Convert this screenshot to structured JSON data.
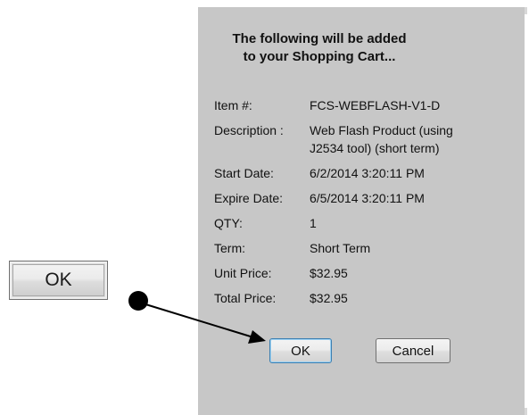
{
  "callout": {
    "ok_label": "OK"
  },
  "dialog": {
    "heading_line1": "The following will be added",
    "heading_line2": "to your Shopping Cart...",
    "fields": {
      "item": {
        "label": "Item #:",
        "value": "FCS-WEBFLASH-V1-D"
      },
      "description": {
        "label": "Description :",
        "value_line1": "Web Flash Product (using",
        "value_line2": "J2534 tool) (short term)"
      },
      "start_date": {
        "label": "Start Date:",
        "value": "6/2/2014 3:20:11 PM"
      },
      "expire_date": {
        "label": "Expire Date:",
        "value": "6/5/2014 3:20:11 PM"
      },
      "qty": {
        "label": "QTY:",
        "value": "1"
      },
      "term": {
        "label": "Term:",
        "value": "Short Term"
      },
      "unit_price": {
        "label": "Unit Price:",
        "value": "$32.95"
      },
      "total_price": {
        "label": "Total Price:",
        "value": "$32.95"
      }
    },
    "ok_label": "OK",
    "cancel_label": "Cancel"
  },
  "colors": {
    "panel_bg": "#c7c7c7",
    "focus_border": "#3c7fb1",
    "arrow": "#000000"
  },
  "icons": {
    "callout_dot": "filled-circle",
    "pointer_arrow": "arrow-right"
  }
}
